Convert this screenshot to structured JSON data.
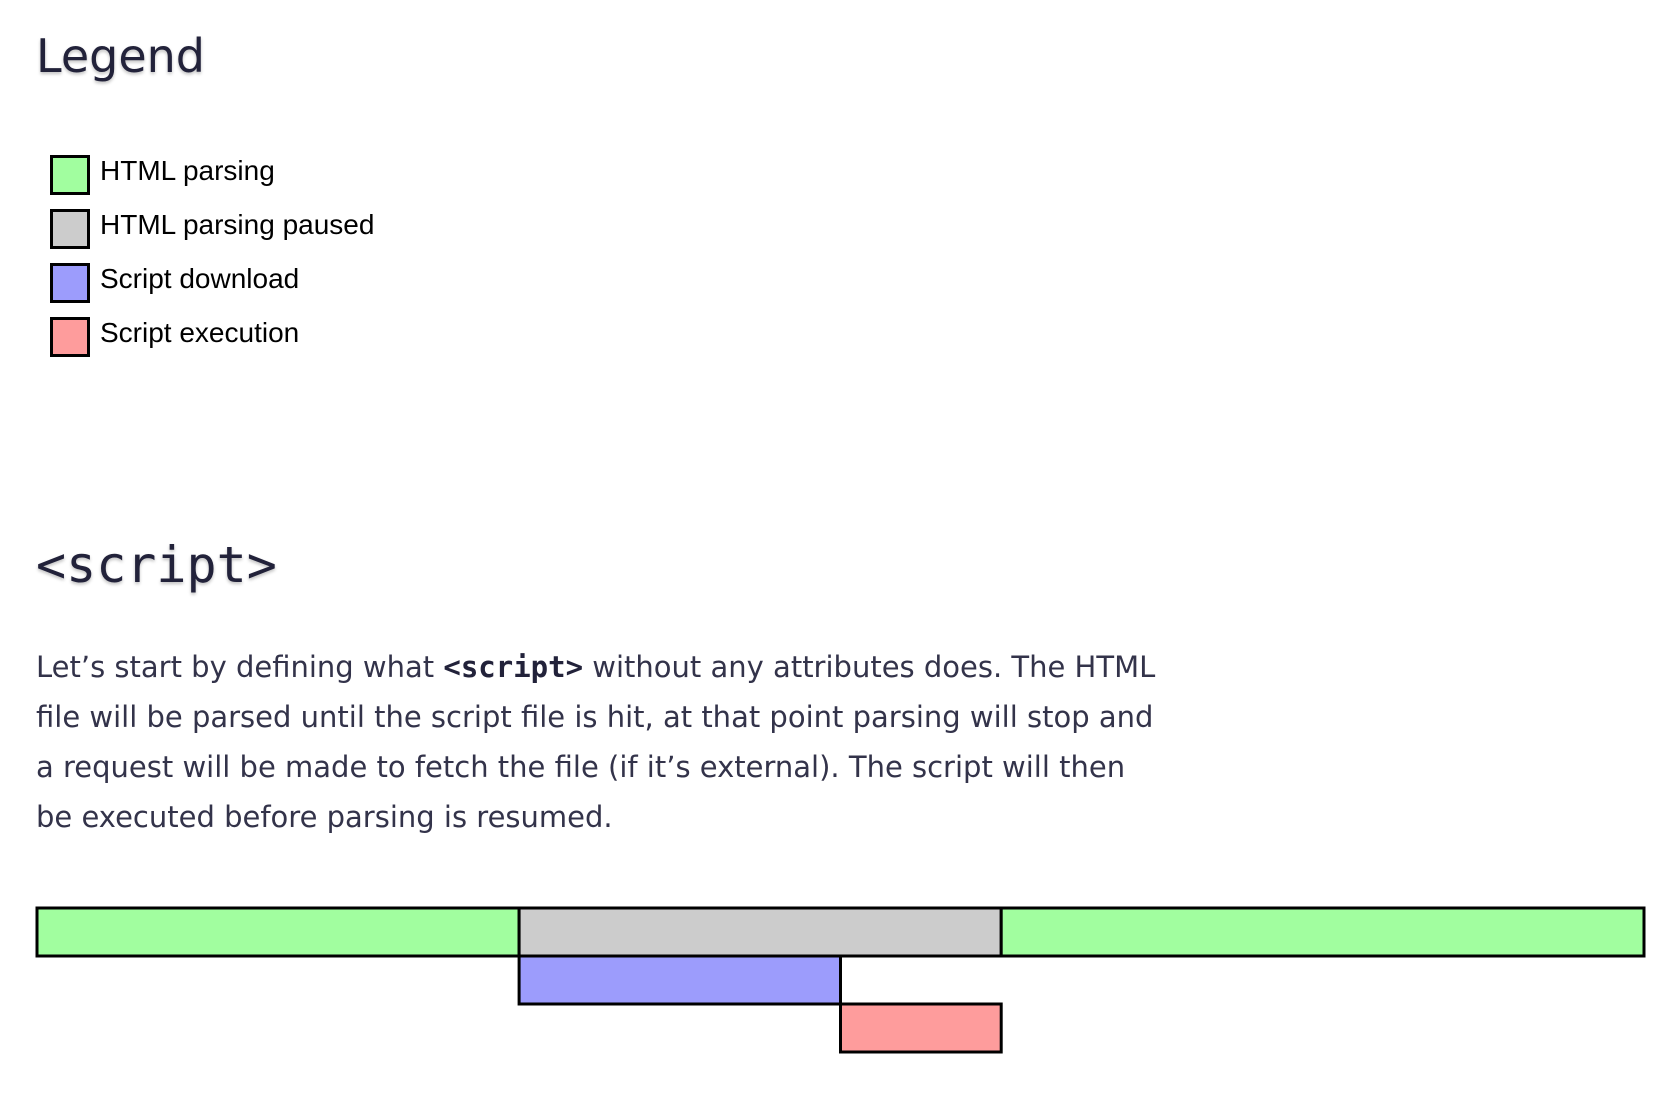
{
  "legend": {
    "title": "Legend",
    "items": [
      {
        "label": "HTML parsing",
        "color": "#a1fe9f"
      },
      {
        "label": "HTML parsing paused",
        "color": "#cccccc"
      },
      {
        "label": "Script download",
        "color": "#9c9cfc"
      },
      {
        "label": "Script execution",
        "color": "#fe9c9c"
      }
    ]
  },
  "section": {
    "title": "<script>",
    "paragraph": {
      "before": "Let’s start by defining what ",
      "code": "<script>",
      "after": " without any attributes does. The HTML file will be parsed until the script file is hit, at that point parsing will stop and a request will be made to fetch the file (if it’s external). The script will then be executed before parsing is resumed."
    }
  },
  "timeline": {
    "total_units": 10,
    "segments": [
      {
        "kind": "html-parsing",
        "row": 0,
        "start": 0,
        "end": 3,
        "color": "#a1fe9f"
      },
      {
        "kind": "html-parsing-paused",
        "row": 0,
        "start": 3,
        "end": 6,
        "color": "#cccccc"
      },
      {
        "kind": "html-parsing",
        "row": 0,
        "start": 6,
        "end": 10,
        "color": "#a1fe9f"
      },
      {
        "kind": "script-download",
        "row": 1,
        "start": 3,
        "end": 5,
        "color": "#9c9cfc"
      },
      {
        "kind": "script-execution",
        "row": 2,
        "start": 5,
        "end": 6,
        "color": "#fe9c9c"
      }
    ]
  }
}
